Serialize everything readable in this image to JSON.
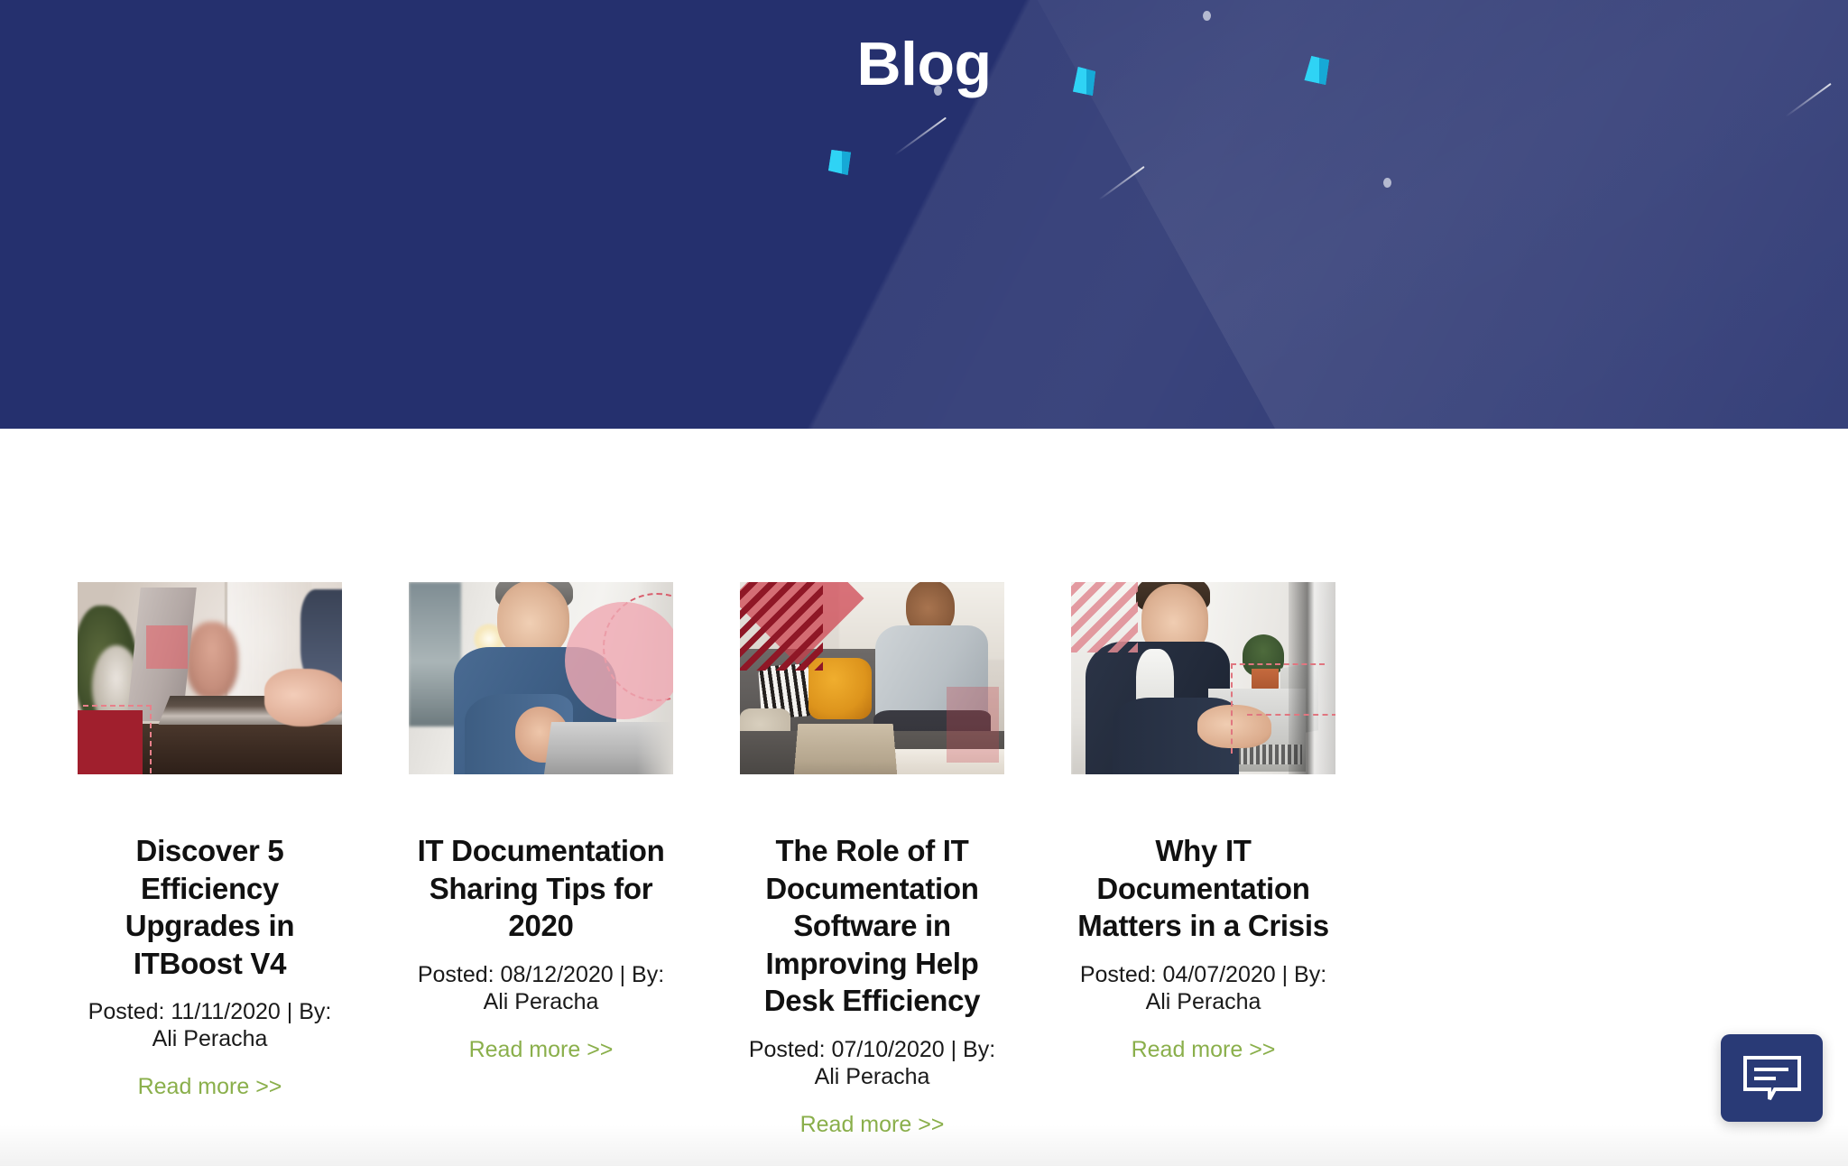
{
  "hero": {
    "title": "Blog",
    "background_color": "#25306e",
    "accent_shape_color": "#22c7ef"
  },
  "theme": {
    "navy": "#25306e",
    "link_green": "#8aaf4b",
    "title_black": "#111111",
    "chat_navy": "#293a76"
  },
  "posts": [
    {
      "title": "Discover 5 Efficiency Upgrades in ITBoost V4",
      "meta": "Posted: 11/11/2020 | By: Ali Peracha",
      "date": "11/11/2020",
      "author": "Ali Peracha",
      "link_label": "Read more >>",
      "image_alt": "person typing on a laptop at a wooden desk with a plant"
    },
    {
      "title": "IT Documentation Sharing Tips for 2020",
      "meta": "Posted: 08/12/2020 | By: Ali Peracha",
      "date": "08/12/2020",
      "author": "Ali Peracha",
      "link_label": "Read more >>",
      "image_alt": "man in a denim shirt working at a laptop in an office"
    },
    {
      "title": "The Role of IT Documentation Software in Improving Help Desk Efficiency",
      "meta": "Posted: 07/10/2020 | By: Ali Peracha",
      "date": "07/10/2020",
      "author": "Ali Peracha",
      "link_label": "Read more >>",
      "image_alt": "man on a phone call taking notes on a couch with a laptop"
    },
    {
      "title": "Why IT Documentation Matters in a Crisis",
      "meta": "Posted: 04/07/2020 | By: Ali Peracha",
      "date": "04/07/2020",
      "author": "Ali Peracha",
      "link_label": "Read more >>",
      "image_alt": "smiling man typing on a laptop near a window"
    }
  ],
  "chat": {
    "icon": "chat-bubble-icon",
    "label": "Open chat"
  }
}
